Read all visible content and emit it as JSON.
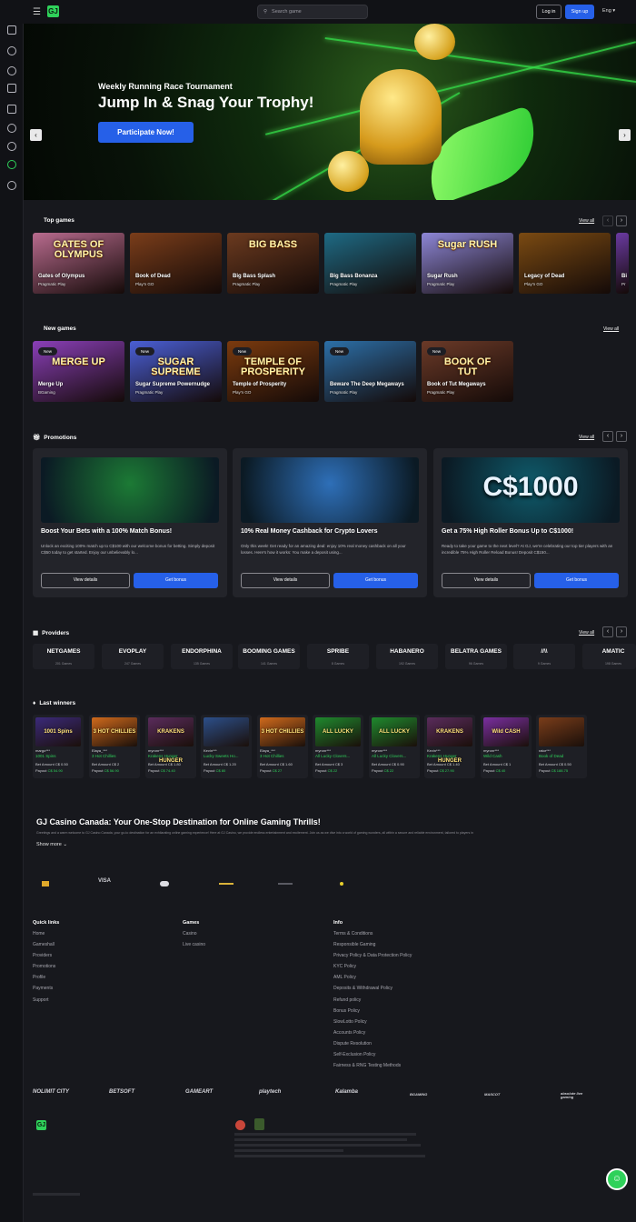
{
  "header": {
    "search_placeholder": "Search game",
    "login_label": "Log in",
    "signup_label": "Sign up",
    "language": "Eng",
    "logo_text": "GJ"
  },
  "hero": {
    "subtitle": "Weekly Running Race Tournament",
    "title": "Jump In & Snag Your Trophy!",
    "cta_label": "Participate Now!",
    "prev_arrow": "‹",
    "next_arrow": "›"
  },
  "top_games": {
    "title": "Top games",
    "view_all": "View all",
    "prev": "‹",
    "next": "›",
    "items": [
      {
        "name": "Gates of Olympus",
        "provider": "Pragmatic Play",
        "art": "GATES OF OLYMPUS",
        "color": "#b86b8e"
      },
      {
        "name": "Book of Dead",
        "provider": "Play'n GO",
        "art": "",
        "color": "#7a3d1a"
      },
      {
        "name": "Big Bass Splash",
        "provider": "Pragmatic Play",
        "art": "BIG BASS",
        "color": "#6b3a1f"
      },
      {
        "name": "Big Bass Bonanza",
        "provider": "Pragmatic Play",
        "art": "",
        "color": "#1e6a84"
      },
      {
        "name": "Sugar Rush",
        "provider": "Pragmatic Play",
        "art": "Sugar RUSH",
        "color": "#8d86d6"
      },
      {
        "name": "Legacy of Dead",
        "provider": "Play'n GO",
        "art": "",
        "color": "#7a4a12"
      },
      {
        "name": "Bi",
        "provider": "Pr",
        "art": "",
        "color": "#6a3aa0"
      }
    ]
  },
  "new_games": {
    "title": "New games",
    "view_all": "View all",
    "badge": "New",
    "items": [
      {
        "name": "Merge Up",
        "provider": "BGaming",
        "art": "MERGE UP",
        "color": "#8a3fb8"
      },
      {
        "name": "Sugar Supreme Powernudge",
        "provider": "Pragmatic Play",
        "art": "SUGAR SUPREME",
        "color": "#4a5fd6"
      },
      {
        "name": "Temple of Prosperity",
        "provider": "Play'n GO",
        "art": "TEMPLE OF PROSPERITY",
        "color": "#7a3a0e"
      },
      {
        "name": "Beware The Deep Megaways",
        "provider": "Pragmatic Play",
        "art": "",
        "color": "#2c6fa8"
      },
      {
        "name": "Book of Tut Megaways",
        "provider": "Pragmatic Play",
        "art": "BOOK OF TUT",
        "color": "#6b3a28"
      }
    ]
  },
  "promotions": {
    "title": "Promotions",
    "view_all": "View all",
    "details_label": "View details",
    "bonus_label": "Get bonus",
    "items": [
      {
        "title": "Boost Your Bets with a 100% Match Bonus!",
        "desc": "Unlock an exciting 100% match up to C$100 with our welcome bonus for betting. Simply deposit C$50 today to get started. Enjoy our unbelievably lo...",
        "color": "#1c7a35",
        "art": ""
      },
      {
        "title": "10% Real Money Cashback for Crypto Lovers",
        "desc": "Only this week! Get ready for an amazing deal: enjoy 10% real money cashback on all your losses. Here's how it works: You make a deposit using...",
        "color": "#2e6fb8",
        "art": ""
      },
      {
        "title": "Get a 75% High Roller Bonus Up to C$1000!",
        "desc": "Ready to take your game to the next level? At GJ, we're celebrating our top tier players with an incredible 75% High Roller Reload Bonus! Deposit C$150...",
        "color": "#0f5a6a",
        "art": "C$1000"
      }
    ]
  },
  "providers": {
    "title": "Providers",
    "view_all": "View all",
    "items": [
      {
        "logo": "NETGAMES",
        "count": "201 Games"
      },
      {
        "logo": "EVOPLAY",
        "count": "247 Games"
      },
      {
        "logo": "ENDORPHINA",
        "count": "135 Games"
      },
      {
        "logo": "BOOMING GAMES",
        "count": "141 Games"
      },
      {
        "logo": "SPRIBE",
        "count": "8 Games"
      },
      {
        "logo": "HABANERO",
        "count": "192 Games"
      },
      {
        "logo": "BELATRA GAMES",
        "count": "96 Games"
      },
      {
        "logo": "//\\\\",
        "count": "9 Games"
      },
      {
        "logo": "AMATIC",
        "count": "198 Games"
      }
    ]
  },
  "winners": {
    "title": "Last winners",
    "bet_prefix": "Bet Amount",
    "payout_prefix": "Payout",
    "items": [
      {
        "user": "margo***",
        "game": "1001 Spins",
        "bet": "C$ 0.50",
        "payout": "C$ 54.90",
        "art": "1001 Spins",
        "color": "#3b2a7a"
      },
      {
        "user": "Elaya_***",
        "game": "3 Hot Chillies",
        "bet": "C$ 2",
        "payout": "C$ 56.90",
        "art": "3 HOT CHILLIES",
        "color": "#d06a1c"
      },
      {
        "user": "myronr***",
        "game": "Krakens Hunger",
        "bet": "C$ 1.80",
        "payout": "C$ 74.40",
        "art": "KRAKENS HUNGER",
        "color": "#5a2c5c"
      },
      {
        "user": "Kevin***",
        "game": "Lucky Sweets Ho...",
        "bet": "C$ 1.20",
        "payout": "C$ 80",
        "art": "",
        "color": "#2c4f8a"
      },
      {
        "user": "Elaya_***",
        "game": "3 Hot Chillies",
        "bet": "C$ 1.60",
        "payout": "C$ 27",
        "art": "3 HOT CHILLIES",
        "color": "#d06a1c"
      },
      {
        "user": "myronr***",
        "game": "All Lucky Clovers...",
        "bet": "C$ 3",
        "payout": "C$ 22",
        "art": "ALL LUCKY",
        "color": "#1f8a2e"
      },
      {
        "user": "myronr***",
        "game": "All Lucky Clovers...",
        "bet": "C$ 0.90",
        "payout": "C$ 22",
        "art": "ALL LUCKY",
        "color": "#1f8a2e"
      },
      {
        "user": "Kevin***",
        "game": "Krakens Hunger",
        "bet": "C$ 1.40",
        "payout": "C$ 27.90",
        "art": "KRAKENS HUNGER",
        "color": "#5a2c5c"
      },
      {
        "user": "myronr***",
        "game": "Wild Cash",
        "bet": "C$ 1",
        "payout": "C$ 40",
        "art": "Wild CASH",
        "color": "#7a2fa0"
      },
      {
        "user": "rator***",
        "game": "Book of Dead",
        "bet": "C$ 0.50",
        "payout": "C$ 188.75",
        "art": "",
        "color": "#7a3d1a"
      }
    ]
  },
  "seo": {
    "title": "GJ Casino Canada: Your One-Stop Destination for Online Gaming Thrills!",
    "text": "Greetings and a warm welcome to GJ Casino Canada, your go-to destination for an exhilarating online gaming experience! Here at GJ Casino, we provide endless entertainment and excitement. Join us as we dive into a world of gaming wonders, all within a secure and reliable environment, tailored to players in",
    "show_more": "Show more"
  },
  "payments": [
    "",
    "VISA",
    "",
    "",
    "",
    ""
  ],
  "footer": {
    "quick_links": {
      "title": "Quick links",
      "items": [
        "Home",
        "Gameshall",
        "Providers",
        "Promotions",
        "Profile",
        "Payments",
        "Support"
      ]
    },
    "games": {
      "title": "Games",
      "items": [
        "Casino",
        "Live casino"
      ]
    },
    "info": {
      "title": "Info",
      "items": [
        "Terms & Conditions",
        "Responsible Gaming",
        "Privacy Policy & Data Protection Policy",
        "KYC Policy",
        "AML Policy",
        "Deposits & Withdrawal Policy",
        "Refund policy",
        "Bonus Policy",
        "SlowLotto Policy",
        "Accounts Policy",
        "Dispute Resolution",
        "Self-Exclusion Policy",
        "Fairness & RNG Testing Methods"
      ]
    },
    "software": [
      "NOLIMIT CITY",
      "BETSOFT",
      "GAMEART",
      "playtech",
      "Kalamba",
      "BGAMING",
      "MASCOT",
      "absolute live gaming"
    ],
    "chat_icon": "☺"
  }
}
